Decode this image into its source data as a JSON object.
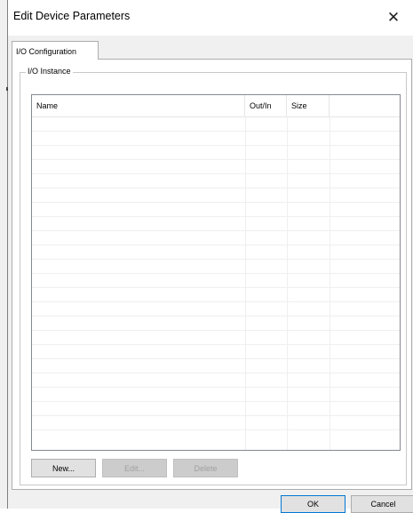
{
  "window": {
    "title": "Edit Device Parameters",
    "close_symbol": "✕"
  },
  "tabs": [
    {
      "label": "I/O Configuration",
      "selected": true
    }
  ],
  "io_instance": {
    "group_label": "I/O Instance",
    "columns": [
      "Name",
      "Out/In",
      "Size",
      ""
    ],
    "rows": []
  },
  "actions": {
    "new_label": "New...",
    "edit_label": "Edit...",
    "delete_label": "Delete"
  },
  "footer": {
    "ok_label": "OK",
    "cancel_label": "Cancel"
  }
}
